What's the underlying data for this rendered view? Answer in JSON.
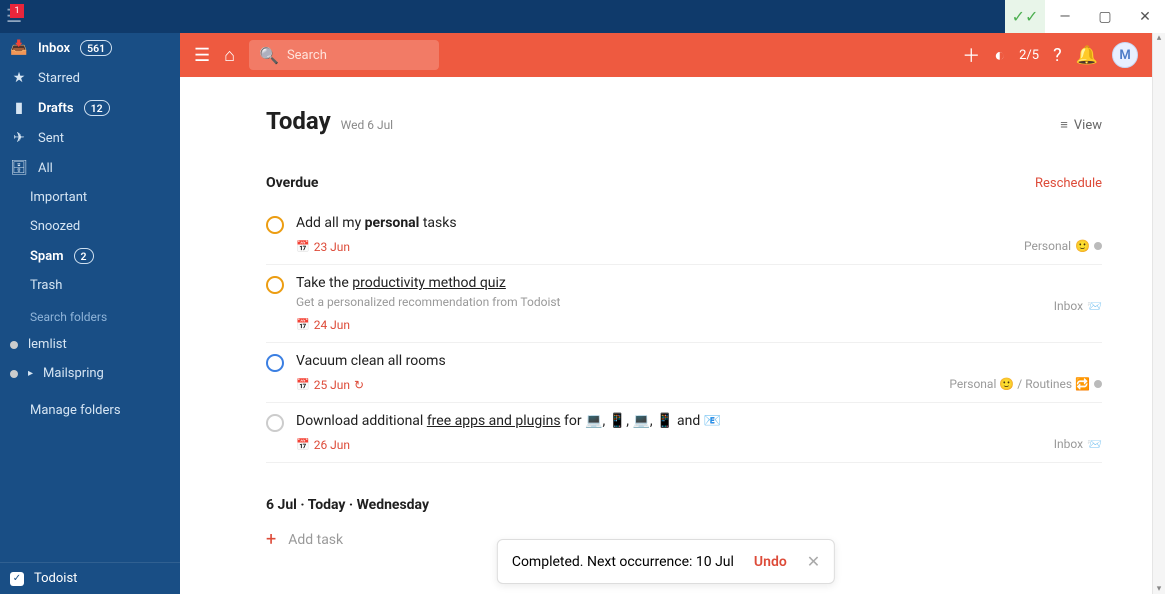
{
  "titlebar": {
    "notif_count": "1"
  },
  "window": {
    "min": "—",
    "max": "▢",
    "close": "✕",
    "sync": "✓✓"
  },
  "sidebar": {
    "items": [
      {
        "icon": "inbox",
        "label": "Inbox",
        "badge": "561",
        "bold": true
      },
      {
        "icon": "star",
        "label": "Starred",
        "bold": false
      },
      {
        "icon": "drafts",
        "label": "Drafts",
        "badge": "12",
        "bold": true
      },
      {
        "icon": "sent",
        "label": "Sent",
        "bold": false
      },
      {
        "icon": "all",
        "label": "All",
        "bold": false
      },
      {
        "icon": "",
        "label": "Important",
        "bold": false
      },
      {
        "icon": "",
        "label": "Snoozed",
        "bold": false
      },
      {
        "icon": "",
        "label": "Spam",
        "badge": "2",
        "bold": true
      },
      {
        "icon": "",
        "label": "Trash",
        "bold": false
      }
    ],
    "search_label": "Search folders",
    "accounts": [
      {
        "label": "lemlist",
        "dot": true
      },
      {
        "label": "Mailspring",
        "arrow": true,
        "dot": true
      }
    ],
    "manage": "Manage folders",
    "footer": {
      "label": "Todoist"
    }
  },
  "header": {
    "search_placeholder": "Search",
    "karma": "2/5",
    "avatar": "M"
  },
  "page": {
    "title": "Today",
    "date": "Wed 6 Jul",
    "view_label": "View"
  },
  "overdue": {
    "title": "Overdue",
    "reschedule": "Reschedule",
    "tasks": [
      {
        "priority": "p2",
        "title_pre": "Add all my ",
        "title_bold": "personal",
        "title_post": " tasks",
        "date": "23 Jun",
        "project": "Personal",
        "project_emoji": "🙂"
      },
      {
        "priority": "p2",
        "title_pre": "Take the ",
        "title_link": "productivity method quiz",
        "desc": "Get a personalized recommendation from Todoist",
        "date": "24 Jun",
        "project": "Inbox",
        "project_icon": "📨"
      },
      {
        "priority": "p3",
        "title": "Vacuum clean all rooms",
        "date": "25 Jun",
        "recurring": true,
        "project": "Personal 🙂 / Routines 🔁"
      },
      {
        "priority": "",
        "title_pre": "Download additional ",
        "title_link": "free apps and plugins",
        "title_post": " for 💻, 📱, 💻, 📱 and 📧",
        "date": "26 Jun",
        "project": "Inbox",
        "project_icon": "📨"
      }
    ]
  },
  "today_section": {
    "title": "6 Jul · Today · Wednesday",
    "add_task": "Add task"
  },
  "toast": {
    "message": "Completed. Next occurrence: 10 Jul",
    "undo": "Undo"
  }
}
